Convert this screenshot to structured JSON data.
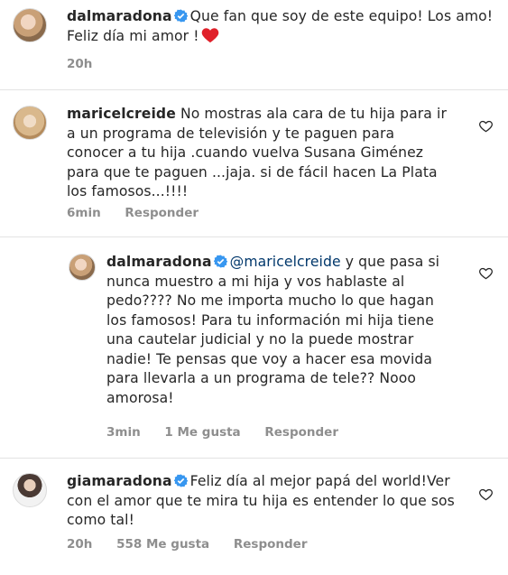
{
  "comments": [
    {
      "username": "dalmaradona",
      "verified": true,
      "text": "Que fan que soy de este equipo! Los amo! Feliz día mi amor !",
      "emoji": "red-heart",
      "time": "20h"
    },
    {
      "username": "maricelcreide",
      "verified": false,
      "text": "No mostras ala cara de tu hija para ir a un programa de televisión y te paguen para conocer  a tu hija .cuando vuelva Susana Giménez  para que te paguen ...jaja. si de fácil hacen La Plata los famosos...!!!!",
      "time": "6min",
      "reply": "Responder"
    },
    {
      "username": "dalmaradona",
      "verified": true,
      "mention": "@maricelcreide",
      "text": "y que pasa si nunca muestro a mi hija y vos hablaste al pedo???? No me importa mucho lo que hagan los famosos! Para tu información mi hija tiene una cautelar judicial y no la puede mostrar nadie! Te pensas que voy a hacer esa movida para llevarla a un programa de tele?? Nooo amorosa!",
      "time": "3min",
      "likes": "1 Me gusta",
      "reply": "Responder"
    },
    {
      "username": "giamaradona",
      "verified": true,
      "text": "Feliz día al mejor papá del world!Ver con el amor que te mira tu hija es entender lo que sos como tal!",
      "time": "20h",
      "likes": "558 Me gusta",
      "reply": "Responder"
    }
  ],
  "colors": {
    "verified": "#3897f0",
    "meta": "#8e8e8e",
    "mention": "#00376b",
    "heart": "#ed4956"
  }
}
